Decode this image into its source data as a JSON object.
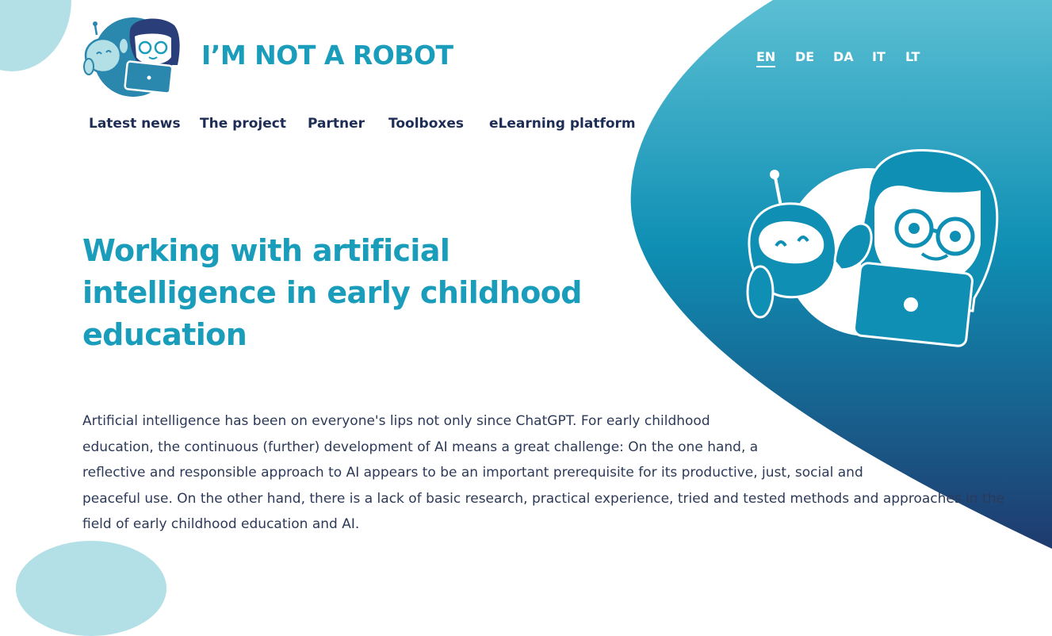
{
  "site": {
    "brand": "I’M NOT A ROBOT",
    "logo_icon": "robot-and-child-logo"
  },
  "languages": [
    {
      "code": "EN",
      "active": true
    },
    {
      "code": "DE",
      "active": false
    },
    {
      "code": "DA",
      "active": false
    },
    {
      "code": "IT",
      "active": false
    },
    {
      "code": "LT",
      "active": false
    }
  ],
  "nav": {
    "items": [
      "Latest news",
      "The project",
      "Partner",
      "Toolboxes",
      "eLearning platform"
    ]
  },
  "hero": {
    "headline": [
      "Working with artificial",
      "intelligence in early childhood",
      "education"
    ],
    "intro_lines": [
      "Artificial intelligence has been on everyone's lips not only since ChatGPT. For early childhood",
      "education, the continuous (further) development of AI means a great challenge: On the one hand, a",
      "reflective and responsible approach to AI appears to be an important prerequisite for its productive, just, social and",
      "peaceful use. On the other hand, there is a lack of basic research, practical experience, tried and tested methods and approaches in the",
      "field of early childhood education and AI."
    ],
    "illustration_icon": "robot-and-child-with-laptop-illustration"
  },
  "colors": {
    "brand_teal": "#1a9cbb",
    "nav_navy": "#1e2d55",
    "gradient_top": "#5bbfd3",
    "gradient_mid": "#0f8fb4",
    "gradient_bottom": "#1f3a6e",
    "light_blob": "#b3e0e6"
  }
}
